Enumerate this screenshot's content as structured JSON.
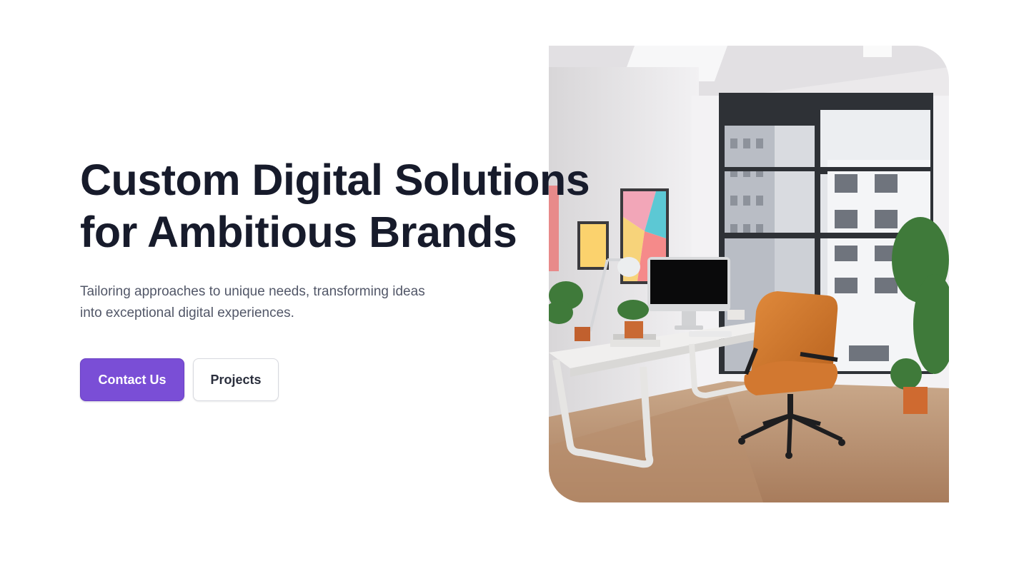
{
  "hero": {
    "headline_line1": "Custom Digital Solutions",
    "headline_line2": "for Ambitious Brands",
    "subtitle_line1": "Tailoring approaches to unique needs, transforming ideas",
    "subtitle_line2": "into exceptional digital experiences.",
    "primary_button": "Contact Us",
    "secondary_button": "Projects",
    "image": "office-workspace-photo"
  },
  "colors": {
    "accent": "#7a4ed6",
    "heading": "#171b2b",
    "body_text": "#525768",
    "background": "#ffffff"
  }
}
